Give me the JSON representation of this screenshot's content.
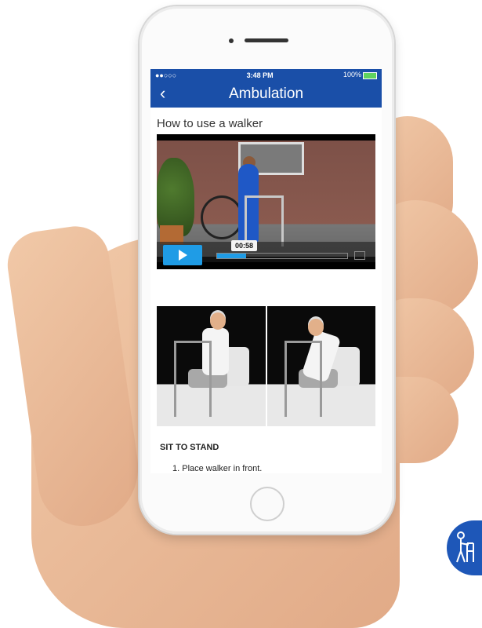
{
  "status_bar": {
    "signal": "●●○○○",
    "time": "3:48 PM",
    "battery": "100%"
  },
  "nav": {
    "back_icon": "chevron-left-icon",
    "title": "Ambulation"
  },
  "content": {
    "section_title": "How to use a walker",
    "video": {
      "timestamp": "00:58",
      "progress": 0.22
    },
    "instruction_heading": "SIT TO STAND",
    "steps": [
      "1.  Place walker in front."
    ]
  },
  "colors": {
    "header": "#1a4fa8",
    "play_button": "#1f9ce6",
    "logo": "#1e57b8"
  },
  "icons": [
    "chevron-left-icon",
    "play-icon",
    "airplay-icon",
    "walker-person-icon"
  ]
}
